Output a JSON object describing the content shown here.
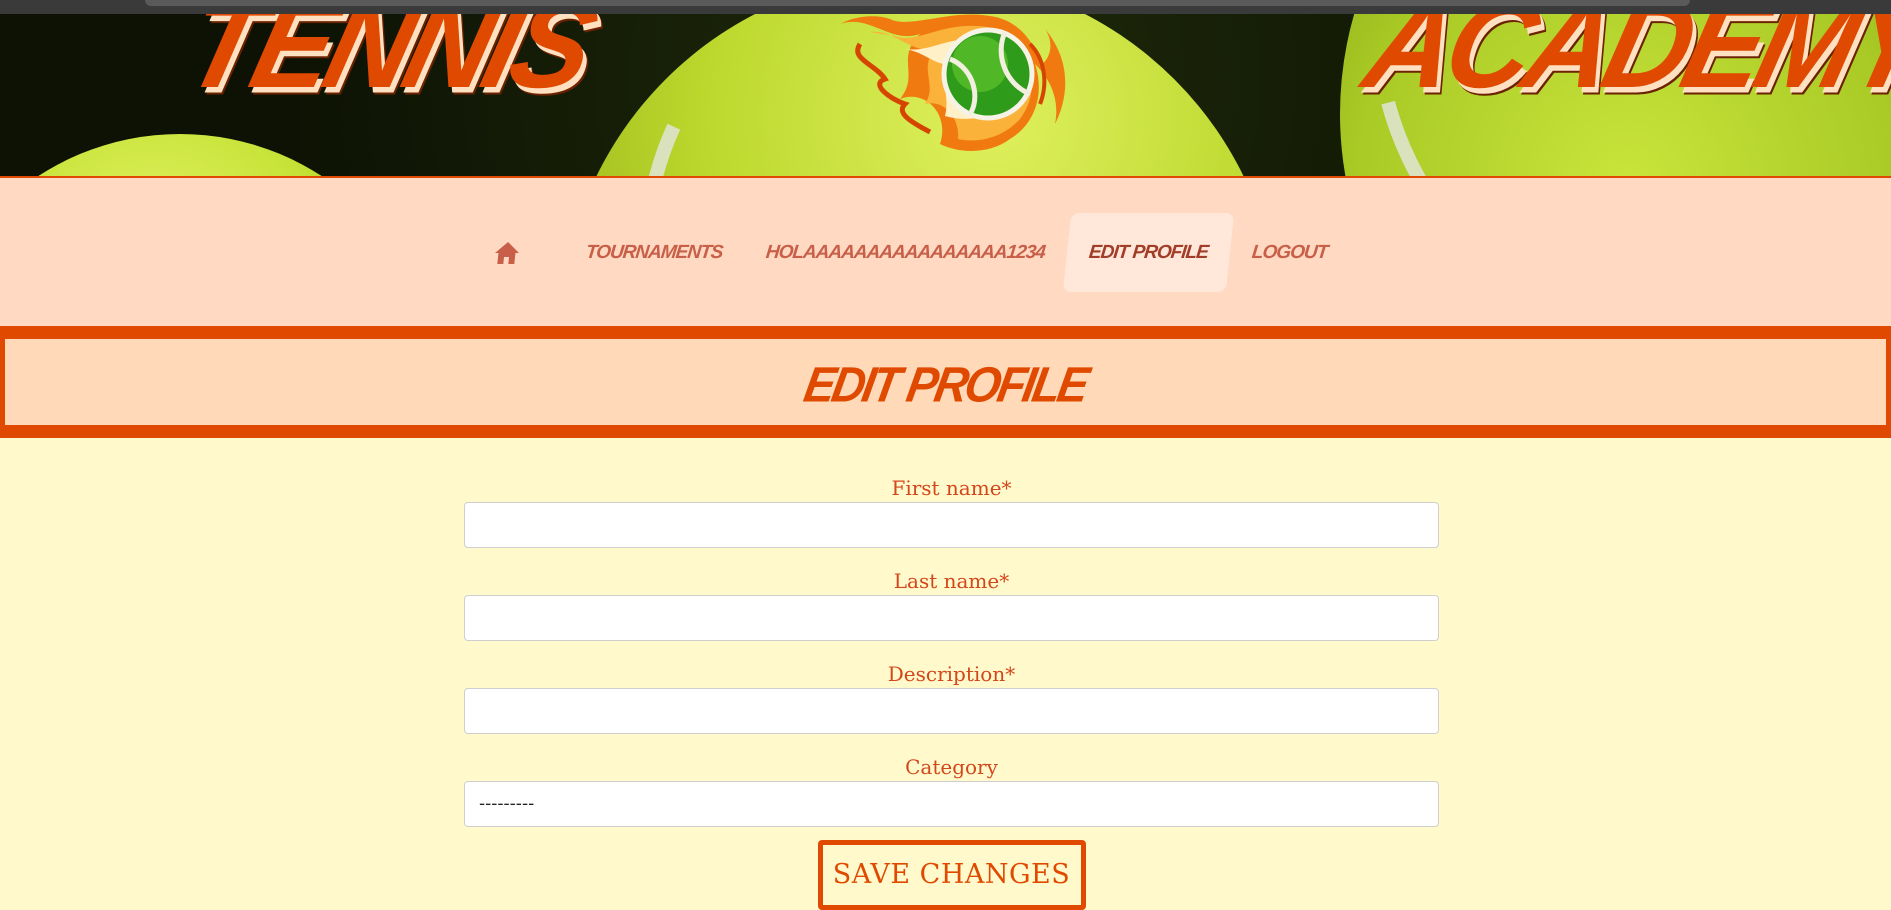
{
  "header": {
    "title_left": "TENNIS",
    "title_right": "ACADEMY",
    "logo_icon": "flaming-tennis-ball-logo"
  },
  "nav": {
    "home_icon": "home-icon",
    "items": [
      {
        "label": "TOURNAMENTS",
        "active": false
      },
      {
        "label": "HOLAAAAAAAAAAAAAAAA1234",
        "active": false
      },
      {
        "label": "EDIT PROFILE",
        "active": true
      },
      {
        "label": "LOGOUT",
        "active": false
      }
    ]
  },
  "page": {
    "title": "EDIT PROFILE"
  },
  "form": {
    "first_name": {
      "label": "First name*",
      "value": ""
    },
    "last_name": {
      "label": "Last name*",
      "value": ""
    },
    "description": {
      "label": "Description*",
      "value": ""
    },
    "category": {
      "label": "Category",
      "selected": "---------"
    },
    "save_label": "SAVE CHANGES"
  },
  "colors": {
    "accent": "#e04a00",
    "nav_bg": "#ffd9c2",
    "page_bg": "#fff9cc",
    "label_text": "#d3471b",
    "nav_text": "#c85f48"
  }
}
